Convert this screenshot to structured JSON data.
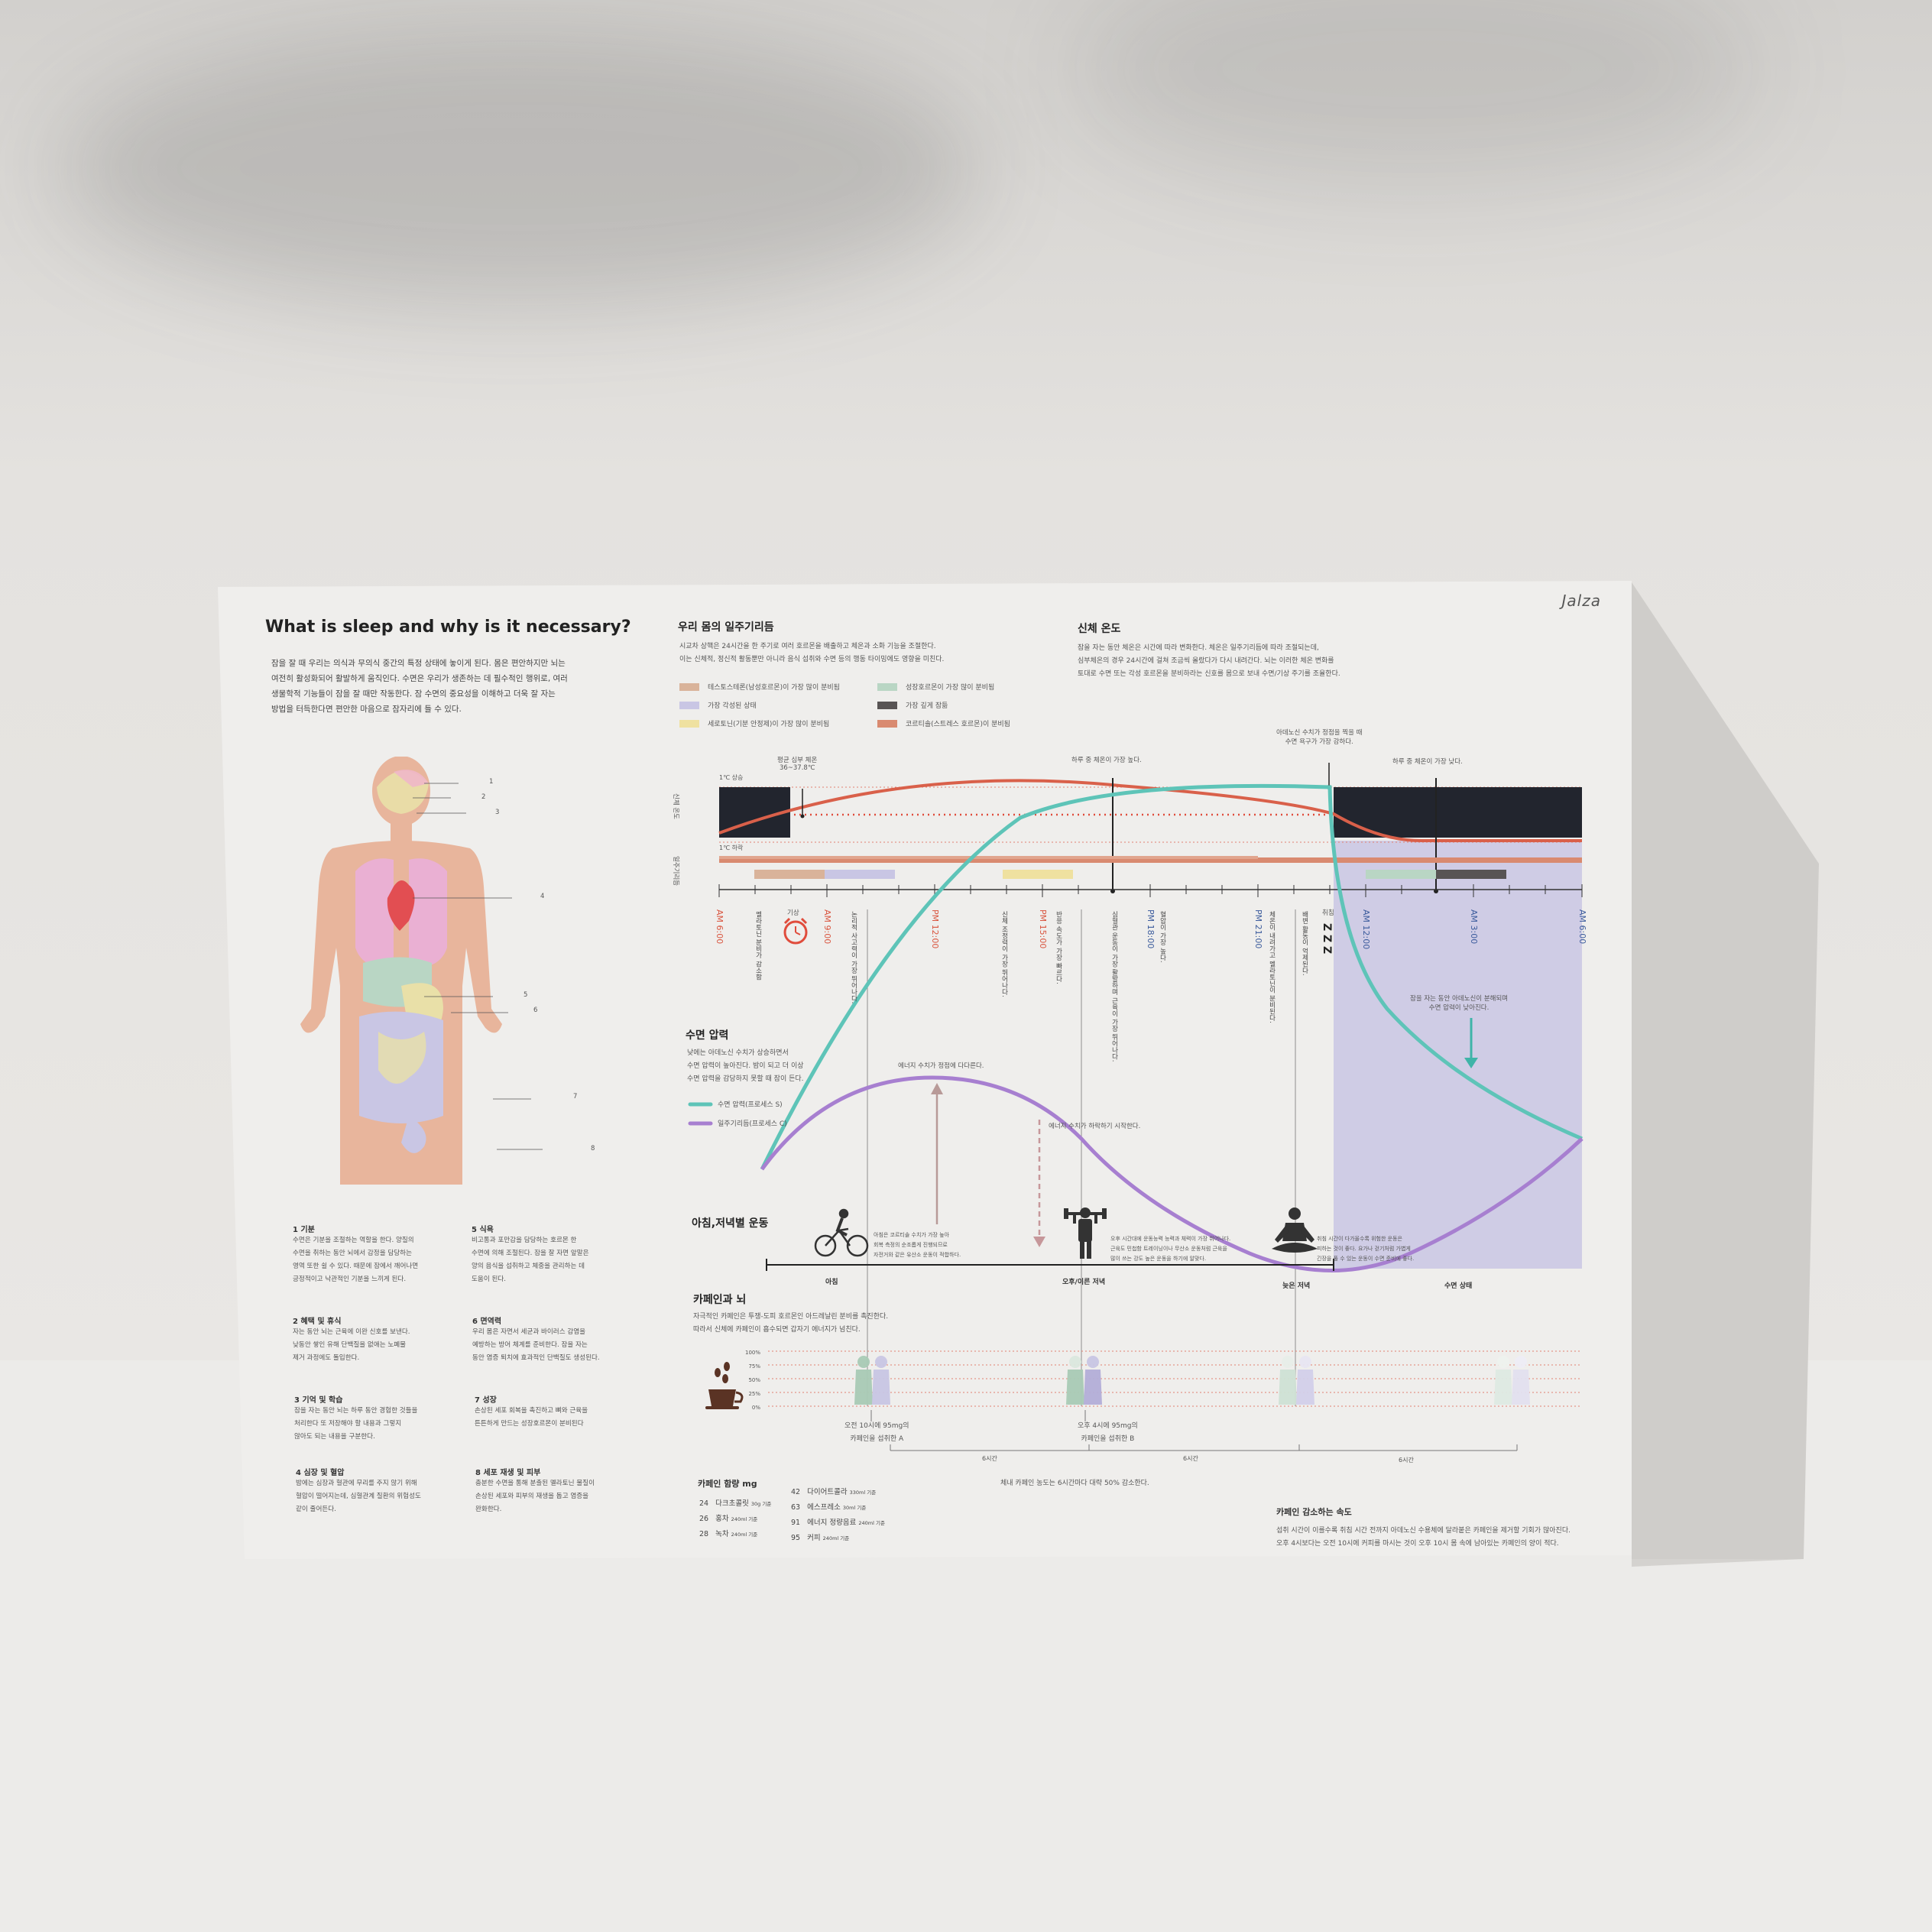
{
  "brand": "Jalza",
  "title": "What is sleep and why is it necessary?",
  "intro": [
    "잠을 잘 때 우리는 의식과 무의식 중간의 특정 상태에 놓이게 된다. 몸은 편안하지만 뇌는",
    "여전히 활성화되어 활발하게 움직인다. 수면은 우리가 생존하는 데 필수적인 행위로, 여러",
    "생물학적 기능들이 잠을 잘 때만 작동한다. 잠 수면의 중요성을 이해하고 더욱 잘 자는",
    "방법을 터득한다면 편안한 마음으로 잠자리에 들 수 있다."
  ],
  "body_numbers": [
    "1",
    "2",
    "3",
    "4",
    "5",
    "6",
    "7",
    "8"
  ],
  "organs": [
    {
      "title": "1  기분",
      "lines": [
        "수면은 기분을 조절하는 역할을 한다. 양질의",
        "수면을 취하는 동안 뇌에서 감정을 담당하는",
        "영역 또한 쉴 수 있다. 때문에 잠에서 깨어나면",
        "긍정적이고 낙관적인 기분을 느끼게 된다."
      ]
    },
    {
      "title": "2  혜택 및 휴식",
      "lines": [
        "자는 동안 뇌는 근육에 이완 신호를 보낸다.",
        "낮동안 쌓인 유해 단백질을 없애는 노폐물",
        "제거 과정에도 돌입한다."
      ]
    },
    {
      "title": "3  기억 및 학습",
      "lines": [
        "잠을 자는 동안 뇌는 하루 동안 경험한 것들을",
        "처리한다 또 저장해야 할 내용과 그렇지",
        "않아도 되는 내용을 구분한다."
      ]
    },
    {
      "title": "4  심장 및 혈압",
      "lines": [
        "밤에는 심장과 혈관에 무리를 주지 않기 위해",
        "혈압이 떨어지는데, 심혈관계 질환의 위험성도",
        "같이 줄어든다."
      ]
    },
    {
      "title": "5  식욕",
      "lines": [
        "비고통과 포만감을 담당하는 호르몬   한",
        "수면에 의해 조절된다. 잠을 잘 자면 앞말은",
        "양의 음식을 섭취하고 체중을 관리하는 데",
        "도움이 된다."
      ]
    },
    {
      "title": "6  면역력",
      "lines": [
        "우리 몸은 자면서 세균과 바이러스 감염을",
        "예방하는 방어 체계를 준비한다. 잠을 자는",
        "동안 염증 퇴치에 효과적인 단백질도 생성된다."
      ]
    },
    {
      "title": "7  성장",
      "lines": [
        "손상된 세포 회복을 촉진하고 뼈와 근육을",
        "튼튼하게 만드는 성장호르몬이 분비된다"
      ]
    },
    {
      "title": "8  세포 재생 및 피부",
      "lines": [
        "충분한 수면을 통해 분출된 멜라토닌 물질이",
        "손상된 세포와 피부의 재생을 돕고 염증을",
        "완화한다."
      ]
    }
  ],
  "circadian": {
    "title": "우리 몸의 일주기리듬",
    "desc": [
      "시교차 상핵은 24시간을 한 주기로 여러 호르몬을 배출하고 체온과 소화 기능을 조절한다.",
      "이는 신체적, 정신적 활동뿐만 아니라 음식 섭취와 수면 등의 행동 타이밍에도 영향을 미친다."
    ],
    "legend": [
      {
        "label": "테스토스테론(남성호르몬)이 가장 많이 분비됨",
        "color": "#d9b39a"
      },
      {
        "label": "가장 각성된 상태",
        "color": "#c9c6e4"
      },
      {
        "label": "세로토닌(기분 안정제)이 가장 많이 분비됨",
        "color": "#efe1a0"
      },
      {
        "label": "성장호르몬이 가장 많이 분비됨",
        "color": "#b9d6c4"
      },
      {
        "label": "가장 깊게 잠듦",
        "color": "#585454"
      },
      {
        "label": "코르티솔(스트레스 호르몬)이 분비됨",
        "color": "#d98a70"
      }
    ]
  },
  "temperature": {
    "title": "신체 온도",
    "desc": [
      "잠을 자는 동안 체온은 시간에 따라 변화한다. 체온은 일주기리듬에 따라 조절되는데,",
      "심부체온의 경우 24시간에 걸쳐 조금씩 올랐다가 다시 내려간다. 뇌는 이러한 체온 변화를",
      "토대로 수면 또는 각성 호르몬을 분비하라는 신호를 몸으로 보내 수면/기상 주기를 조율한다."
    ]
  },
  "chart_labels": {
    "y_temp": "신체 온도",
    "y_rhythm": "일주기리듬",
    "up": "1℃ 상승",
    "down": "1℃ 하락",
    "avg": "평균 심부 체온",
    "avg_range": "36~37.8℃",
    "peak_day": "하루 중 체온이 가장 높다.",
    "adenosine": "아데노신 수치가 정점을 찍을 때",
    "adenosine2": "수면 욕구가 가장 강하다.",
    "low_day": "하루 중 체온이 가장 낮다.",
    "wake": "기상",
    "sleep_go": "취침",
    "zzz": "Z Z Z",
    "sleep_note1": "잠을 자는 동안 아데노신이 분해되며",
    "sleep_note2": "수면 압력이 낮아진다."
  },
  "times": [
    {
      "label": "AM 6:00",
      "color": "#d9543e"
    },
    {
      "label": "AM 9:00",
      "color": "#d9543e"
    },
    {
      "label": "PM 12:00",
      "color": "#d9543e"
    },
    {
      "label": "PM 15:00",
      "color": "#d9543e"
    },
    {
      "label": "PM 18:00",
      "color": "#3b5b9c"
    },
    {
      "label": "PM 21:00",
      "color": "#3b5b9c"
    },
    {
      "label": "AM 12:00",
      "color": "#3b5b9c"
    },
    {
      "label": "AM 3:00",
      "color": "#3b5b9c"
    },
    {
      "label": "AM 6:00",
      "color": "#3b5b9c"
    }
  ],
  "events": [
    "멜라토닌 분비가 감소함",
    "논리적 사고력이 가장 뛰어나다.",
    "신체 조정력이 가장 뛰어나다.",
    "반응 속도가 가장 빠르다.",
    "심혈관 운동이 가장 활발하며 근육이 가장 뛰어나다.",
    "혈압이 가장 높다.",
    "체온이 내려가고 멜라토닌이 분비된다.",
    "배변 활동이 억제된다."
  ],
  "sleep_pressure": {
    "title": "수면 압력",
    "desc": [
      "낮에는 아데노신 수치가 상승하면서",
      "수면 압력이 높아진다. 밤이 되고 더 이상",
      "수면 압력을 감당하지 못할 때 잠이 든다."
    ],
    "legend": [
      {
        "label": "수면 압력(프로세스 S)",
        "color": "#5ec4b8"
      },
      {
        "label": "일주기리듬(프로세스 C)",
        "color": "#a77fd0"
      }
    ],
    "energy_peak": "에너지 수치가 정점에 다다른다.",
    "energy_drop": "에너지 수치가 하락하기 시작한다."
  },
  "exercise": {
    "title": "아침,저녁별 운동",
    "notes": [
      [
        "아침은 코르티솔 수치가 가장 높아",
        "회복 측정의 순조롭게 진행되므로",
        "자전거와 같은 유산소 운동이 적합하다."
      ],
      [
        "오후 시간대에 운동능력 능력과 체력이 가장 뛰어나다.",
        "근육도 민첩함 트레이닝이나 무산소 운동처럼 근육을",
        "많이 쓰는 강도 높은 운동을 하기에 알맞다."
      ],
      [
        "취침 시간이 다가올수록 위험한 운동은",
        "피하는 것이 좋다. 요가나 걷기처럼 가볍게",
        "긴장을 풀 수 있는 운동이 수면 준비에 좋다."
      ]
    ],
    "segments": [
      "아침",
      "오후/이른 저녁",
      "늦은 저녁",
      "수면 상태"
    ]
  },
  "caffeine": {
    "title": "카페인과 뇌",
    "desc": [
      "자극적인 카페인은 투쟁-도피 호르몬인 아드레날린 분비를 촉진한다.",
      "따라서 신체에 카페인이 흡수되면 갑자기 에너지가 넘친다."
    ],
    "levels": [
      "100%",
      "75%",
      "50%",
      "25%",
      "0%"
    ],
    "captionA": [
      "오전 10시에 95mg의",
      "카페인을 섭취한 A"
    ],
    "captionB": [
      "오후 4시에 95mg의",
      "카페인을 섭취한 B"
    ],
    "intervals": [
      "6시간",
      "6시간",
      "6시간"
    ],
    "halflife": "체내 카페인 농도는 6시간마다 대략 50% 감소한다.",
    "content_title": "카페인 함량 mg",
    "content": [
      {
        "mg": "24",
        "name": "다크초콜릿",
        "unit": "30g 기준"
      },
      {
        "mg": "26",
        "name": "홍차",
        "unit": "240ml 기준"
      },
      {
        "mg": "28",
        "name": "녹차",
        "unit": "240ml 기준"
      },
      {
        "mg": "42",
        "name": "다이어트콜라",
        "unit": "330ml 기준"
      },
      {
        "mg": "63",
        "name": "에스프레소",
        "unit": "30ml 기준"
      },
      {
        "mg": "91",
        "name": "에너지 정량음료",
        "unit": "240ml 기준"
      },
      {
        "mg": "95",
        "name": "커피",
        "unit": "240ml 기준"
      }
    ],
    "decay_title": "카페인 감소하는 속도",
    "decay_desc": [
      "섭취 시간이 이를수록 취침 시간 전까지 아데노신 수용체에 달라붙은 카페인을 제거할 기회가 많아진다.",
      "오후 4시보다는 오전 10시에 커피를 마시는 것이 오후 10시 몸 속에 남아있는 카페인의 양이 적다."
    ]
  }
}
